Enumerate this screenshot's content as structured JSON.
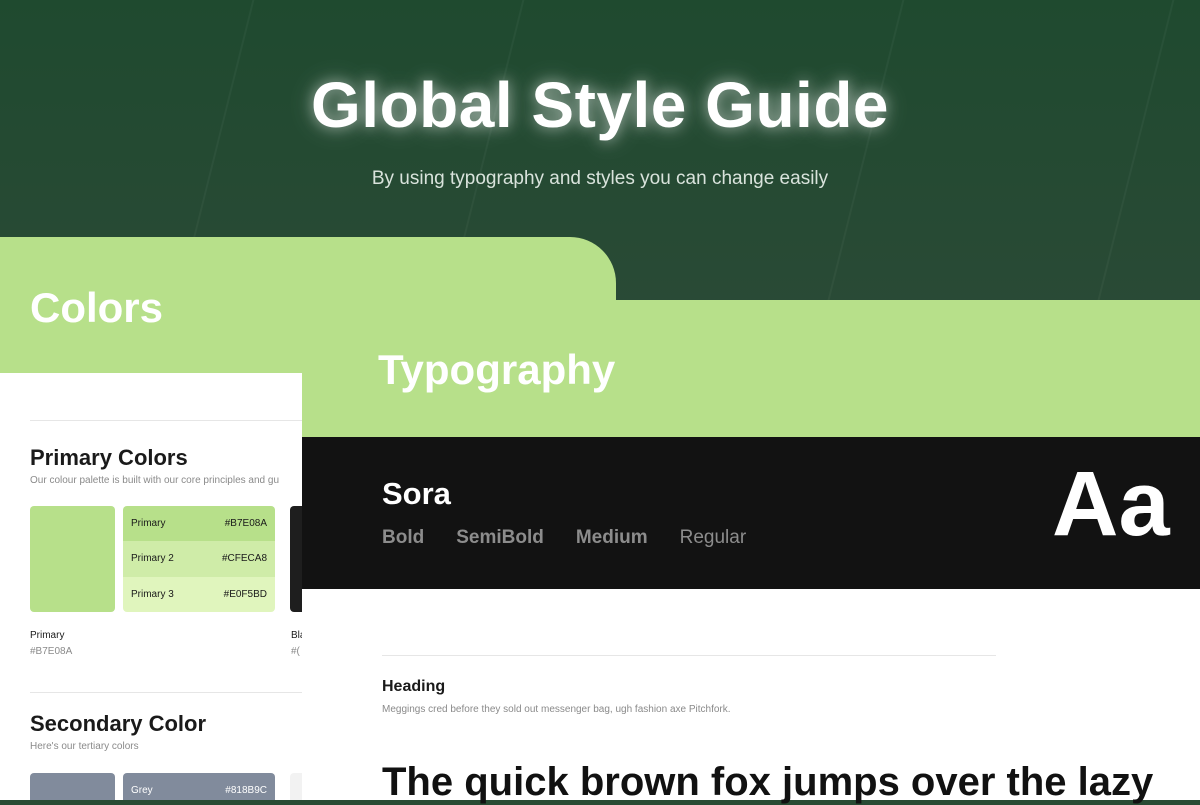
{
  "hero": {
    "title": "Global Style Guide",
    "subtitle": "By using typography and styles you can change easily"
  },
  "colors": {
    "title": "Colors",
    "primary": {
      "heading": "Primary Colors",
      "description": "Our colour palette is built with our core principles and gu",
      "main_swatch": {
        "label": "Primary",
        "hex": "#B7E08A",
        "color": "#B7E08A"
      },
      "shades": [
        {
          "name": "Primary",
          "hex": "#B7E08A",
          "color": "#B7E08A"
        },
        {
          "name": "Primary 2",
          "hex": "#CFECA8",
          "color": "#CFECA8"
        },
        {
          "name": "Primary 3",
          "hex": "#E0F5BD",
          "color": "#E0F5BD"
        }
      ],
      "next_swatch": {
        "label": "Bla",
        "hex": "#(",
        "color": "#1E1E1E"
      }
    },
    "secondary": {
      "heading": "Secondary Color",
      "description": "Here's our tertiary colors",
      "main_swatch_color": "#818B9C",
      "shade": {
        "name": "Grey",
        "hex": "#818B9C",
        "color": "#818B9C"
      },
      "next_swatch_color": "#F2F2F2"
    }
  },
  "typography": {
    "title": "Typography",
    "font_name": "Sora",
    "weights": [
      "Bold",
      "SemiBold",
      "Medium",
      "Regular"
    ],
    "specimen": "Aa",
    "heading_label": "Heading",
    "heading_desc": "Meggings cred before they sold out messenger bag, ugh fashion axe Pitchfork.",
    "sample": "The quick brown fox jumps over the lazy"
  }
}
